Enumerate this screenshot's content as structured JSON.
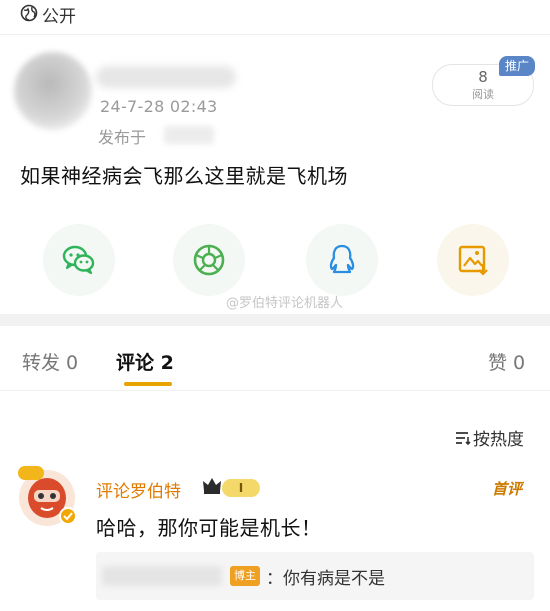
{
  "visibility": {
    "label": "公开",
    "icon": "globe-icon"
  },
  "post": {
    "time": "24-7-28 02:43",
    "published_from_label": "发布于",
    "read_count": "8",
    "read_label": "阅读",
    "promote_badge": "推广",
    "content": "如果神经病会飞那么这里就是飞机场"
  },
  "share": {
    "icons": [
      "wechat-icon",
      "moments-icon",
      "qq-icon",
      "save-image-icon"
    ],
    "colors": {
      "green": "#2fb45a",
      "blue": "#2a8fe0",
      "orange": "#e69a00"
    }
  },
  "watermark": "@罗伯特评论机器人",
  "tabs": {
    "repost": "转发 0",
    "comments": "评论 2",
    "likes": "赞 0"
  },
  "sort": {
    "label": "按热度",
    "icon": "sort-icon"
  },
  "comment": {
    "author": "评论罗伯特",
    "level": "I",
    "badge": "首评",
    "text": "哈哈，那你可能是机长！",
    "reply": {
      "tag": "博主",
      "text": "：你有病是不是"
    }
  },
  "accent": "#e7a400"
}
